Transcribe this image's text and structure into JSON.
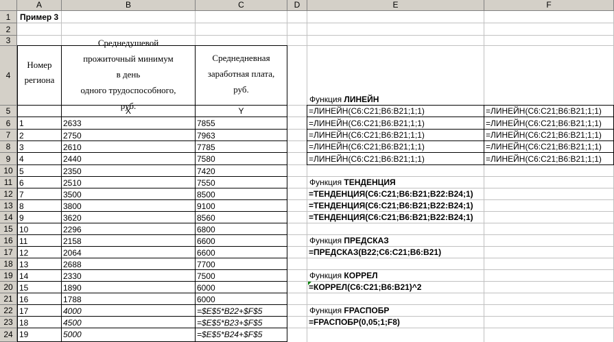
{
  "columns": [
    "A",
    "B",
    "C",
    "D",
    "E",
    "F"
  ],
  "rows": [
    "1",
    "2",
    "3",
    "4",
    "5",
    "6",
    "7",
    "8",
    "9",
    "10",
    "11",
    "12",
    "13",
    "14",
    "15",
    "16",
    "17",
    "18",
    "19",
    "20",
    "21",
    "22",
    "23",
    "24"
  ],
  "title": "Пример 3",
  "table_header": {
    "region": "Номер региона",
    "min_line1": "Среднедушевой",
    "min_line2": "прожиточный минимум",
    "min_line3": "в день",
    "min_line4": "одного трудоспособного,",
    "min_line5": "руб.",
    "wage_line1": "Среднедневная",
    "wage_line2": "заработная плата,",
    "wage_line3": "руб.",
    "x": "X",
    "y": "Y"
  },
  "data_rows": [
    {
      "n": "1",
      "x": "2633",
      "y": "7855"
    },
    {
      "n": "2",
      "x": "2750",
      "y": "7963"
    },
    {
      "n": "3",
      "x": "2610",
      "y": "7785"
    },
    {
      "n": "4",
      "x": "2440",
      "y": "7580"
    },
    {
      "n": "5",
      "x": "2350",
      "y": "7420"
    },
    {
      "n": "6",
      "x": "2510",
      "y": "7550"
    },
    {
      "n": "7",
      "x": "3500",
      "y": "8500"
    },
    {
      "n": "8",
      "x": "3800",
      "y": "9100"
    },
    {
      "n": "9",
      "x": "3620",
      "y": "8560"
    },
    {
      "n": "10",
      "x": "2296",
      "y": "6800"
    },
    {
      "n": "11",
      "x": "2158",
      "y": "6600"
    },
    {
      "n": "12",
      "x": "2064",
      "y": "6600"
    },
    {
      "n": "13",
      "x": "2688",
      "y": "7700"
    },
    {
      "n": "14",
      "x": "2330",
      "y": "7500"
    },
    {
      "n": "15",
      "x": "1890",
      "y": "6000"
    },
    {
      "n": "16",
      "x": "1788",
      "y": "6000"
    },
    {
      "n": "17",
      "x": "4000",
      "y": "=$E$5*B22+$F$5"
    },
    {
      "n": "18",
      "x": "4500",
      "y": "=$E$5*B23+$F$5"
    },
    {
      "n": "19",
      "x": "5000",
      "y": "=$E$5*B24+$F$5"
    }
  ],
  "func_label": "Функция",
  "linest_name": "ЛИНЕЙН",
  "linest_formula": "=ЛИНЕЙН(C6:C21;B6:B21;1;1)",
  "trend_name": "ТЕНДЕНЦИЯ",
  "trend_formula": "=ТЕНДЕНЦИЯ(C6:C21;B6:B21;B22:B24;1)",
  "forecast_name": "ПРЕДСКАЗ",
  "forecast_formula": "=ПРЕДСКАЗ(B22;C6:C21;B6:B21)",
  "correl_name": "КОРРЕЛ",
  "correl_formula": "=КОРРЕЛ(C6:C21;B6:B21)^2",
  "finv_name": "FРАСПОБР",
  "finv_formula": "=FРАСПОБР(0,05;1;F8)"
}
